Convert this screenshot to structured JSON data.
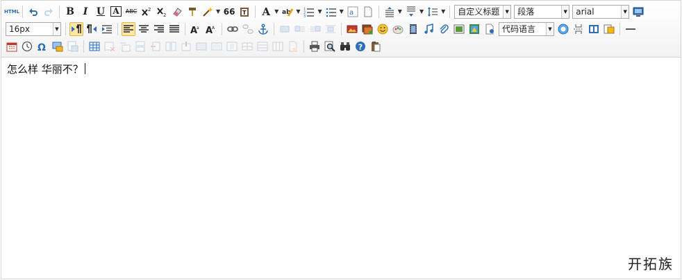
{
  "toolbar": {
    "html_label": "HTML",
    "bold_label": "B",
    "italic_label": "I",
    "underline_label": "U",
    "border_label": "A",
    "strike_label": "ABC",
    "font_color_label": "A",
    "quote_label": "66",
    "custom_title_select": "自定义标题",
    "paragraph_select": "段落",
    "font_family_select": "arial",
    "font_size_select": "16px",
    "code_language_select": "代码语言"
  },
  "editor": {
    "content_text": "怎么样 华丽不？"
  },
  "watermark": {
    "text": "开拓族"
  },
  "colors": {
    "active_bg": "#fce7a9",
    "icon_blue": "#2f6db5",
    "border": "#d4d4d4"
  }
}
